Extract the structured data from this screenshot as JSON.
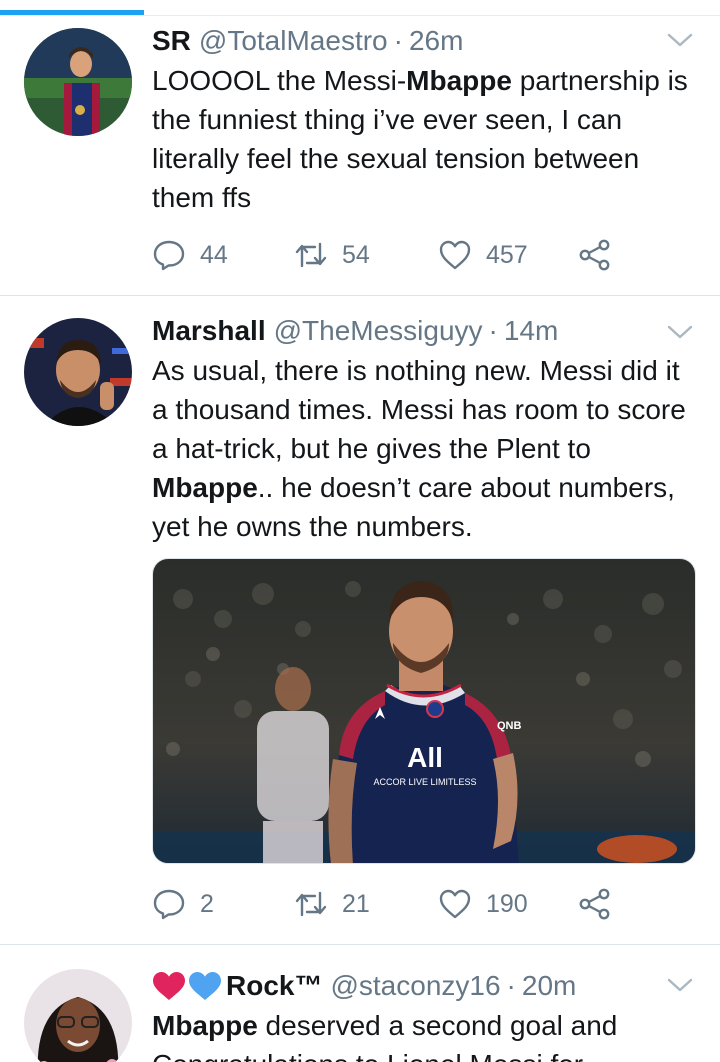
{
  "tweets": [
    {
      "name": "SR",
      "handle": "@TotalMaestro",
      "time": "26m",
      "text_before": "LOOOOL the Messi-",
      "text_bold": "Mbappe",
      "text_after": " partnership is the funniest thing i’ve ever seen, I can literally feel the sexual tension between them ffs",
      "replies": "44",
      "retweets": "54",
      "likes": "457"
    },
    {
      "name": "Marshall",
      "handle": "@TheMessiguyy",
      "time": "14m",
      "text_before": "As usual, there is nothing new. Messi did it a thousand times. Messi has room to score a hat-trick, but he gives the Plent to ",
      "text_bold": "Mbappe",
      "text_after": ".. he doesn’t care about numbers, yet he owns the numbers.",
      "media_sponsor": "QNB",
      "media_shirt_main": "All",
      "media_shirt_sub": "ACCOR LIVE LIMITLESS",
      "replies": "2",
      "retweets": "21",
      "likes": "190"
    },
    {
      "name_suffix": "Rock™",
      "handle": "@staconzy16",
      "time": "20m",
      "text_bold": "Mbappe",
      "text_after": " deserved a second goal and",
      "text_line2": "Congratulations to Lionel Messi for"
    }
  ],
  "separator_dot": "·",
  "colors": {
    "accent": "#1da1f2",
    "secondary_text": "#657786",
    "heart_red": "#e0245e",
    "heart_blue": "#1da1f2"
  }
}
